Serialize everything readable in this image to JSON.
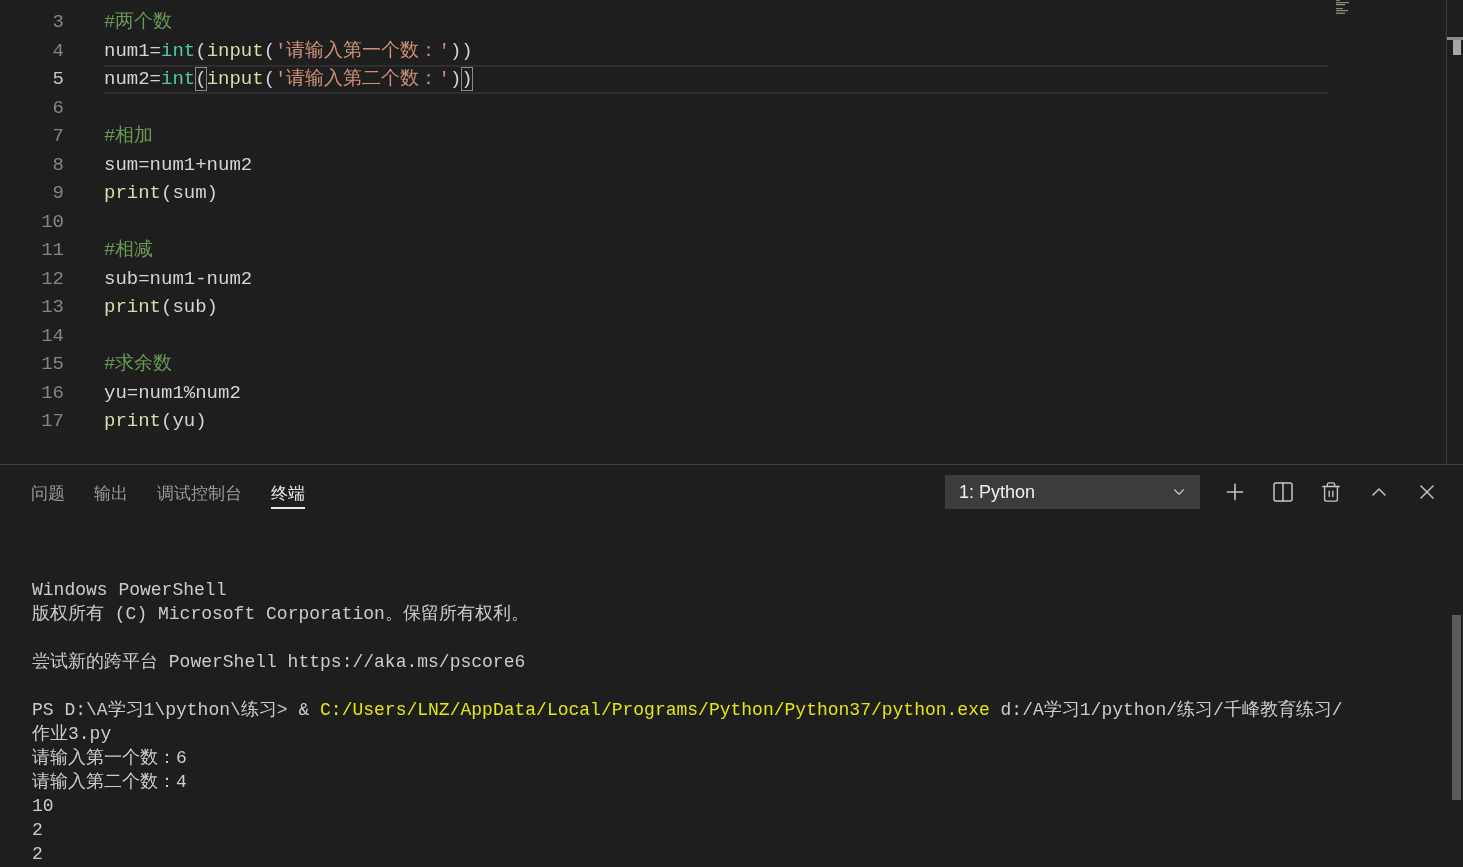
{
  "editor": {
    "lines": [
      {
        "number": "3",
        "current": false,
        "tokens": [
          {
            "kind": "comment",
            "text": "#两个数"
          }
        ]
      },
      {
        "number": "4",
        "current": false,
        "tokens": [
          {
            "kind": "plain",
            "text": "num1="
          },
          {
            "kind": "type",
            "text": "int"
          },
          {
            "kind": "plain",
            "text": "("
          },
          {
            "kind": "function",
            "text": "input"
          },
          {
            "kind": "plain",
            "text": "("
          },
          {
            "kind": "string",
            "text": "'请输入第一个数：'"
          },
          {
            "kind": "plain",
            "text": "))"
          }
        ]
      },
      {
        "number": "5",
        "current": true,
        "tokens": [
          {
            "kind": "plain",
            "text": "num2="
          },
          {
            "kind": "type",
            "text": "int"
          },
          {
            "kind": "bracket",
            "text": "("
          },
          {
            "kind": "function",
            "text": "input"
          },
          {
            "kind": "plain",
            "text": "("
          },
          {
            "kind": "string",
            "text": "'请输入第二个数：'"
          },
          {
            "kind": "plain",
            "text": ")"
          },
          {
            "kind": "bracket",
            "text": ")"
          }
        ]
      },
      {
        "number": "6",
        "current": false
      },
      {
        "number": "7",
        "current": false,
        "tokens": [
          {
            "kind": "comment",
            "text": "#相加"
          }
        ]
      },
      {
        "number": "8",
        "current": false,
        "tokens": [
          {
            "kind": "plain",
            "text": "sum=num1+num2"
          }
        ]
      },
      {
        "number": "9",
        "current": false,
        "tokens": [
          {
            "kind": "function",
            "text": "print"
          },
          {
            "kind": "plain",
            "text": "(sum)"
          }
        ]
      },
      {
        "number": "10",
        "current": false
      },
      {
        "number": "11",
        "current": false,
        "tokens": [
          {
            "kind": "comment",
            "text": "#相减"
          }
        ]
      },
      {
        "number": "12",
        "current": false,
        "tokens": [
          {
            "kind": "plain",
            "text": "sub=num1-num2"
          }
        ]
      },
      {
        "number": "13",
        "current": false,
        "tokens": [
          {
            "kind": "function",
            "text": "print"
          },
          {
            "kind": "plain",
            "text": "(sub)"
          }
        ]
      },
      {
        "number": "14",
        "current": false
      },
      {
        "number": "15",
        "current": false,
        "tokens": [
          {
            "kind": "comment",
            "text": "#求余数"
          }
        ]
      },
      {
        "number": "16",
        "current": false,
        "tokens": [
          {
            "kind": "plain",
            "text": "yu=num1%num2"
          }
        ]
      },
      {
        "number": "17",
        "current": false,
        "tokens": [
          {
            "kind": "function",
            "text": "print"
          },
          {
            "kind": "plain",
            "text": "(yu)"
          }
        ]
      }
    ]
  },
  "panel": {
    "tabs": [
      {
        "label": "问题",
        "selected": false
      },
      {
        "label": "输出",
        "selected": false
      },
      {
        "label": "调试控制台",
        "selected": false
      },
      {
        "label": "终端",
        "selected": true
      }
    ],
    "terminal_picker": {
      "value": "1: Python"
    },
    "terminal": {
      "blocks": [
        {
          "lines": [
            {
              "segments": [
                {
                  "kind": "plain",
                  "text": "Windows PowerShell"
                }
              ]
            },
            {
              "segments": [
                {
                  "kind": "plain",
                  "text": "版权所有 (C) Microsoft Corporation。保留所有权利。"
                }
              ]
            }
          ]
        },
        {
          "lines": [
            {
              "segments": [
                {
                  "kind": "plain",
                  "text": "尝试新的跨平台 PowerShell https://aka.ms/pscore6"
                }
              ]
            }
          ]
        },
        {
          "lines": [
            {
              "segments": [
                {
                  "kind": "plain",
                  "text": "PS D:\\A学习1\\python\\练习> & "
                },
                {
                  "kind": "path",
                  "text": "C:/Users/LNZ/AppData/Local/Programs/Python/Python37/python.exe"
                },
                {
                  "kind": "plain",
                  "text": " d:/A学习1/python/练习/千峰教育练习/"
                }
              ]
            },
            {
              "segments": [
                {
                  "kind": "plain",
                  "text": "作业3.py"
                }
              ]
            },
            {
              "segments": [
                {
                  "kind": "plain",
                  "text": "请输入第一个数：6"
                }
              ]
            },
            {
              "segments": [
                {
                  "kind": "plain",
                  "text": "请输入第二个数：4"
                }
              ]
            },
            {
              "segments": [
                {
                  "kind": "plain",
                  "text": "10"
                }
              ]
            },
            {
              "segments": [
                {
                  "kind": "plain",
                  "text": "2"
                }
              ]
            },
            {
              "segments": [
                {
                  "kind": "plain",
                  "text": "2"
                }
              ]
            }
          ]
        }
      ]
    }
  }
}
